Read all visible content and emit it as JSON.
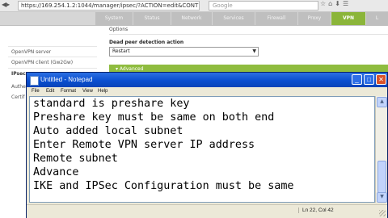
{
  "browser": {
    "url": "https://169.254.1.2:1044/manager/ipsec/?ACTION=edit&CONTRO",
    "search_placeholder": "Google",
    "icons": [
      "back-icon",
      "star-icon",
      "home-icon",
      "download-icon"
    ]
  },
  "router_nav": {
    "tabs": [
      "System",
      "Status",
      "Network",
      "Services",
      "Firewall",
      "Proxy",
      "VPN",
      "L"
    ],
    "active_tab": "VPN",
    "active_color": "#8bb53a"
  },
  "router_main": {
    "options_label": "Options",
    "dpd_label": "Dead peer detection action",
    "dpd_value": "Restart",
    "advanced_label": "▾ Advanced"
  },
  "side_menu": {
    "items": [
      "OpenVPN server",
      "OpenVPN client (Gw2Gw)",
      "IPsec",
      "Authe",
      "Certif"
    ]
  },
  "notepad": {
    "title": "Untitled - Notepad",
    "menu": [
      "File",
      "Edit",
      "Format",
      "View",
      "Help"
    ],
    "lines": [
      "standard is preshare key",
      "Preshare key must be same on both end",
      "Auto added local subnet",
      "Enter Remote VPN server IP address",
      "Remote subnet",
      "Advance",
      "IKE and IPSec Configuration must be same"
    ],
    "status": "Ln 22, Col 42",
    "title_bar_color": "#0a4fd0"
  }
}
